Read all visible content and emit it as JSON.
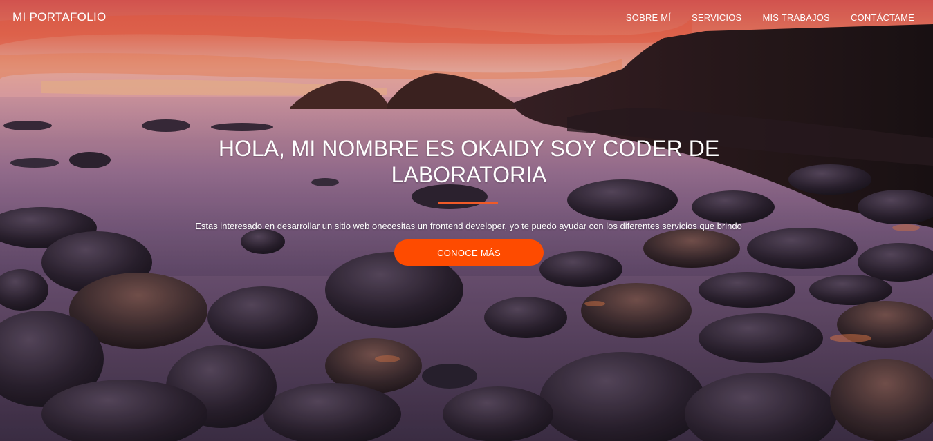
{
  "nav": {
    "brand": "MI PORTAFOLIO",
    "items": [
      {
        "label": "SOBRE MÍ"
      },
      {
        "label": "SERVICIOS"
      },
      {
        "label": "MIS TRABAJOS"
      },
      {
        "label": "CONTÁCTAME"
      }
    ]
  },
  "hero": {
    "title": "HOLA, MI NOMBRE ES OKAIDY SOY CODER DE LABORATORIA",
    "subtitle": "Estas interesado en desarrollar un sitio web onecesitas un frontend developer, yo te puedo ayudar con los diferentes servicios que brindo",
    "cta_label": "CONOCE MÁS"
  },
  "colors": {
    "accent": "#fe4b00",
    "rule": "#f05a28",
    "text": "#ffffff"
  }
}
